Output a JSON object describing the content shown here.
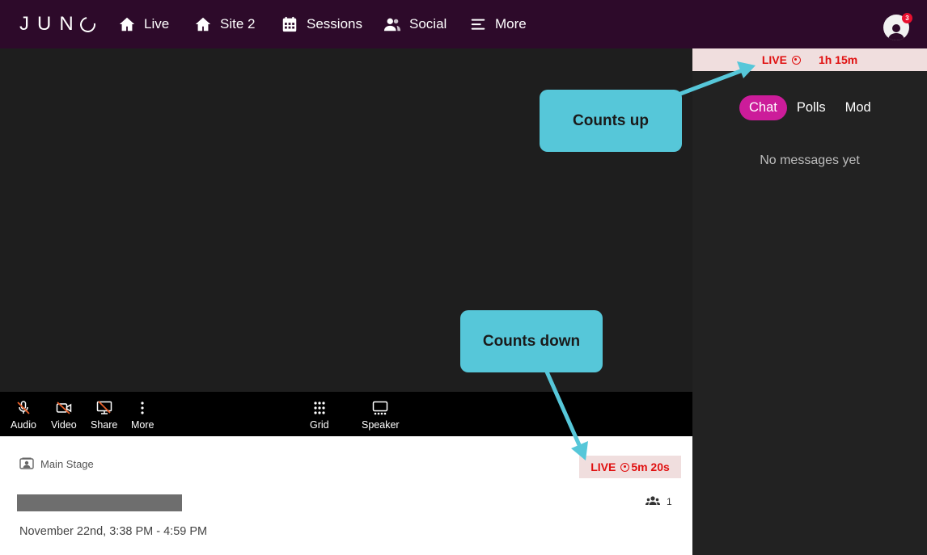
{
  "brand": {
    "logo_text": "JUN"
  },
  "nav": {
    "items": [
      {
        "label": "Live",
        "icon": "home-icon"
      },
      {
        "label": "Site 2",
        "icon": "home-icon"
      },
      {
        "label": "Sessions",
        "icon": "calendar-icon"
      },
      {
        "label": "Social",
        "icon": "people-icon"
      },
      {
        "label": "More",
        "icon": "menu-lines-icon"
      }
    ],
    "notification_count": "3"
  },
  "controls": {
    "audio": "Audio",
    "video": "Video",
    "share": "Share",
    "more": "More",
    "grid": "Grid",
    "speaker": "Speaker"
  },
  "session": {
    "stage": "Main Stage",
    "live_label": "LIVE",
    "countdown": "5m 20s",
    "attendee_count": "1",
    "time_range": "November 22nd, 3:38 PM - 4:59 PM"
  },
  "sidebar": {
    "live_label": "LIVE",
    "elapsed": "1h 15m",
    "tabs": [
      {
        "label": "Chat",
        "active": true
      },
      {
        "label": "Polls",
        "active": false
      },
      {
        "label": "Mod",
        "active": false
      }
    ],
    "empty_text": "No messages yet"
  },
  "callouts": {
    "counts_up": "Counts up",
    "counts_down": "Counts down"
  },
  "colors": {
    "nav_bg": "#2d0a2a",
    "live_red": "#e01010",
    "live_bg": "#f0dede",
    "accent_pink": "#cc1c9a",
    "callout": "#56c7d9"
  }
}
